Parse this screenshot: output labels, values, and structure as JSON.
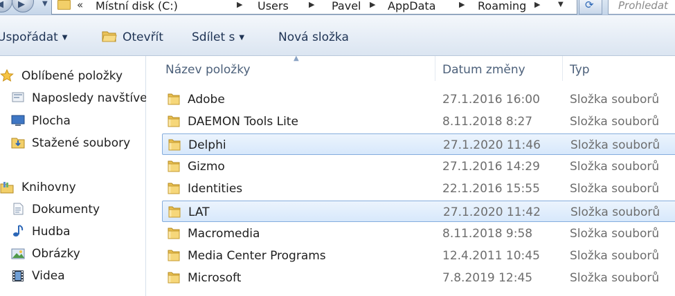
{
  "address": {
    "chevron": "«",
    "crumbs": [
      "Místní disk (C:)",
      "Users",
      "Pavel",
      "AppData",
      "Roaming"
    ],
    "search_placeholder": "Prohledat"
  },
  "toolbar": {
    "organize_label": "Uspořádat",
    "open_label": "Otevřít",
    "share_label": "Sdílet s",
    "new_folder_label": "Nová složka"
  },
  "nav": {
    "favorites": {
      "label": "Oblíbené položky",
      "items": [
        {
          "label": "Naposledy navštívené místa",
          "icon": "recent-places-icon"
        },
        {
          "label": "Plocha",
          "icon": "desktop-icon"
        },
        {
          "label": "Stažené soubory",
          "icon": "downloads-icon"
        }
      ]
    },
    "libraries": {
      "label": "Knihovny",
      "items": [
        {
          "label": "Dokumenty",
          "icon": "documents-icon"
        },
        {
          "label": "Hudba",
          "icon": "music-icon"
        },
        {
          "label": "Obrázky",
          "icon": "pictures-icon"
        },
        {
          "label": "Videa",
          "icon": "videos-icon"
        }
      ]
    }
  },
  "columns": {
    "name": "Název položky",
    "date": "Datum změny",
    "type": "Typ"
  },
  "files": [
    {
      "name": "Adobe",
      "date": "27.1.2016 16:00",
      "type": "Složka souborů",
      "selected": false
    },
    {
      "name": "DAEMON Tools Lite",
      "date": "8.11.2018 8:27",
      "type": "Složka souborů",
      "selected": false
    },
    {
      "name": "Delphi",
      "date": "27.1.2020 11:46",
      "type": "Složka souborů",
      "selected": true
    },
    {
      "name": "Gizmo",
      "date": "27.1.2016 14:29",
      "type": "Složka souborů",
      "selected": false
    },
    {
      "name": "Identities",
      "date": "22.1.2016 15:55",
      "type": "Složka souborů",
      "selected": false
    },
    {
      "name": "LAT",
      "date": "27.1.2020 11:42",
      "type": "Složka souborů",
      "selected": true
    },
    {
      "name": "Macromedia",
      "date": "8.11.2018 9:58",
      "type": "Složka souborů",
      "selected": false
    },
    {
      "name": "Media Center Programs",
      "date": "12.4.2011 10:45",
      "type": "Složka souborů",
      "selected": false
    },
    {
      "name": "Microsoft",
      "date": "7.8.2019 12:45",
      "type": "Složka souborů",
      "selected": false
    }
  ],
  "colors": {
    "selection_fill": "#d7e8fb",
    "selection_border": "#84acdd",
    "folder": "#f2cf69"
  }
}
